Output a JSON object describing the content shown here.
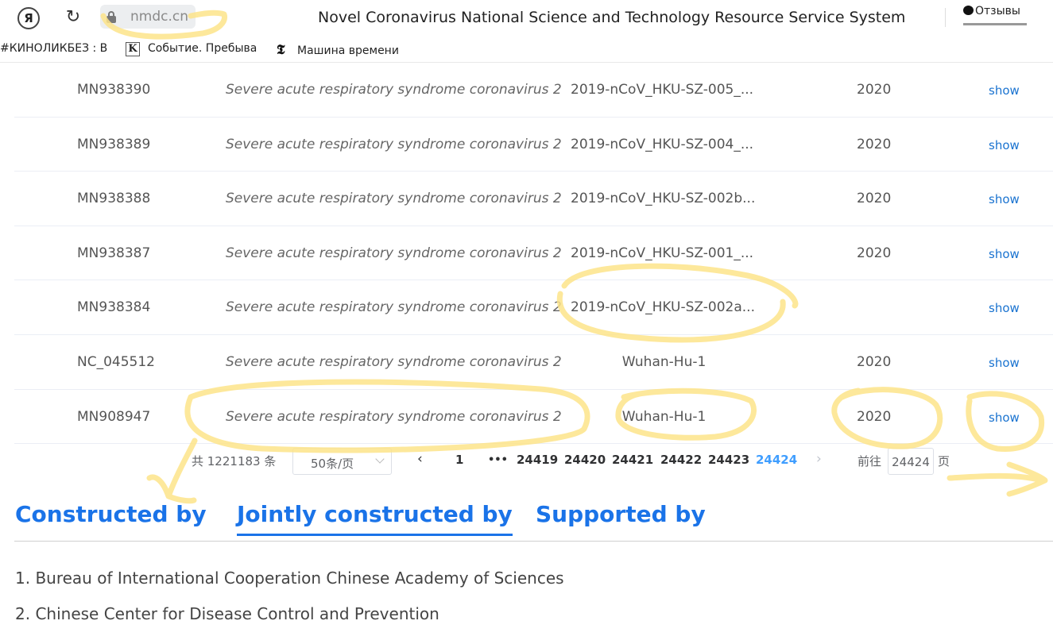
{
  "browser": {
    "yandex_button": "Я",
    "address": "nmdc.cn",
    "page_title": "Novel Coronavirus National Science and Technology Resource Service System",
    "feedback_label": "Отзывы",
    "bookmarks": [
      {
        "label": "#КИНОЛИКБЕЗ : В"
      },
      {
        "label": "Событие. Пребыва"
      },
      {
        "label": "Машина времени"
      }
    ]
  },
  "table": {
    "rows": [
      {
        "accession": "MN938390",
        "species": "Severe acute respiratory syndrome coronavirus 2",
        "strain": "2019-nCoV_HKU-SZ-005_...",
        "year": "2020",
        "action": "show"
      },
      {
        "accession": "MN938389",
        "species": "Severe acute respiratory syndrome coronavirus 2",
        "strain": "2019-nCoV_HKU-SZ-004_...",
        "year": "2020",
        "action": "show"
      },
      {
        "accession": "MN938388",
        "species": "Severe acute respiratory syndrome coronavirus 2",
        "strain": "2019-nCoV_HKU-SZ-002b...",
        "year": "2020",
        "action": "show"
      },
      {
        "accession": "MN938387",
        "species": "Severe acute respiratory syndrome coronavirus 2",
        "strain": "2019-nCoV_HKU-SZ-001_...",
        "year": "2020",
        "action": "show"
      },
      {
        "accession": "MN938384",
        "species": "Severe acute respiratory syndrome coronavirus 2",
        "strain": "2019-nCoV_HKU-SZ-002a...",
        "year": "",
        "action": "show"
      },
      {
        "accession": "NC_045512",
        "species": "Severe acute respiratory syndrome coronavirus 2",
        "strain": "Wuhan-Hu-1",
        "year": "2020",
        "action": "show"
      },
      {
        "accession": "MN908947",
        "species": "Severe acute respiratory syndrome coronavirus 2",
        "strain": "Wuhan-Hu-1",
        "year": "2020",
        "action": "show"
      }
    ]
  },
  "pagination": {
    "total": "共 1221183 条",
    "page_size": "50条/页",
    "prev": "‹",
    "first": "1",
    "ellipsis": "•••",
    "pages": [
      "24419",
      "24420",
      "24421",
      "24422",
      "24423",
      "24424"
    ],
    "current": "24424",
    "next": "›",
    "goto_prefix": "前往",
    "goto_value": "24424",
    "goto_suffix": "页"
  },
  "tabs": [
    {
      "label": "Constructed by"
    },
    {
      "label": "Jointly constructed by"
    },
    {
      "label": "Supported by"
    }
  ],
  "organizations": [
    "1. Bureau of International Cooperation Chinese Academy of Sciences",
    "2. Chinese Center for Disease Control and Prevention"
  ],
  "colors": {
    "link": "#1a73d0",
    "tab_accent": "#1a73e8",
    "active_page": "#409eff",
    "highlighter": "#fde48a"
  },
  "icons": [
    "yandex-icon",
    "reload-icon",
    "lock-icon",
    "feedback-bubble-icon",
    "kommersant-icon",
    "nyt-icon",
    "chevron-down-icon",
    "chevron-left-icon",
    "chevron-right-icon"
  ]
}
